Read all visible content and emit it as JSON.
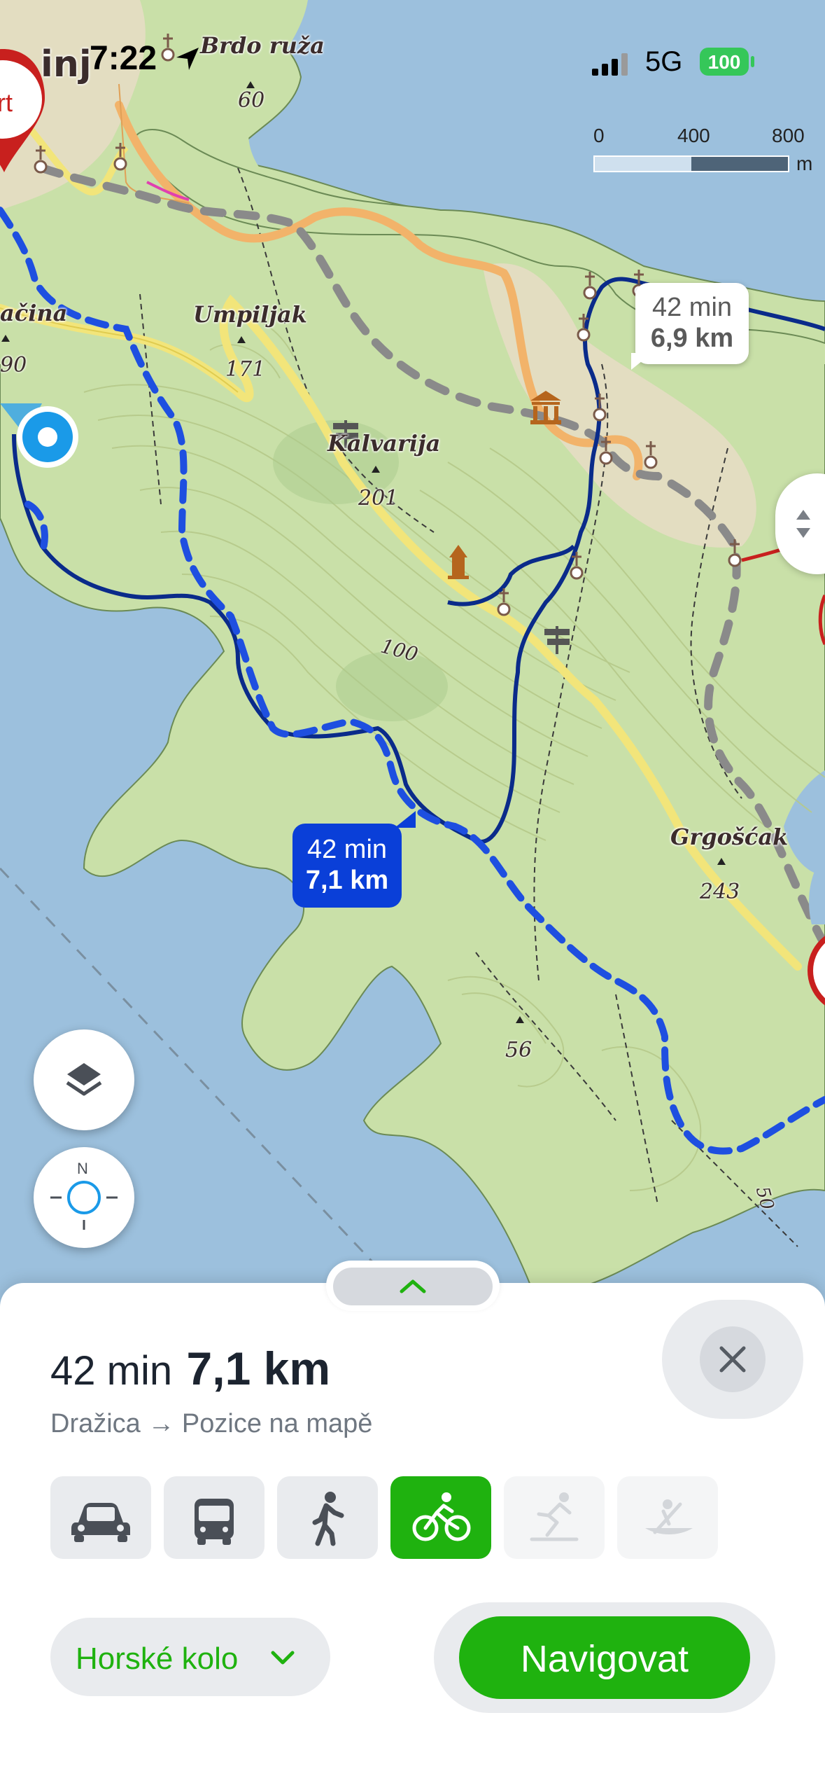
{
  "status_bar": {
    "time": "7:22",
    "network": "5G",
    "battery": "100"
  },
  "map": {
    "scale": {
      "labels": [
        "0",
        "400",
        "800"
      ],
      "unit": "m"
    },
    "place_labels": {
      "brdo_ruza": "Brdo ruža",
      "umpiljak": "Umpiljak",
      "kalvarija": "Kalvarija",
      "grgoscak": "Grgošćak",
      "dracina": "ačina",
      "town_partial": "inj"
    },
    "elevations": {
      "e60": "60",
      "e171": "171",
      "e201": "201",
      "e243": "243",
      "e56": "56",
      "e90": "90",
      "c100": "100",
      "c50": "50"
    },
    "start_marker": "art",
    "route_badge_primary": {
      "time": "42 min",
      "distance": "7,1 km"
    },
    "route_badge_alt": {
      "time": "42 min",
      "distance": "6,9 km"
    },
    "compass_letters": {
      "north": "N"
    }
  },
  "sheet": {
    "time": "42 min",
    "distance": "7,1 km",
    "route_text": "Dražica → Pozice na mapě",
    "transport_modes": [
      {
        "name": "car",
        "active": false,
        "disabled": false
      },
      {
        "name": "bus",
        "active": false,
        "disabled": false
      },
      {
        "name": "walk",
        "active": false,
        "disabled": false
      },
      {
        "name": "bike",
        "active": true,
        "disabled": false
      },
      {
        "name": "ski",
        "active": false,
        "disabled": true
      },
      {
        "name": "boat",
        "active": false,
        "disabled": true
      }
    ],
    "bike_type": "Horské kolo",
    "navigate_label": "Navigovat"
  },
  "colors": {
    "accent_green": "#1fb20f",
    "route_blue": "#0a3fd8",
    "water": "#9cc0dd",
    "land": "#c9e0a8"
  }
}
